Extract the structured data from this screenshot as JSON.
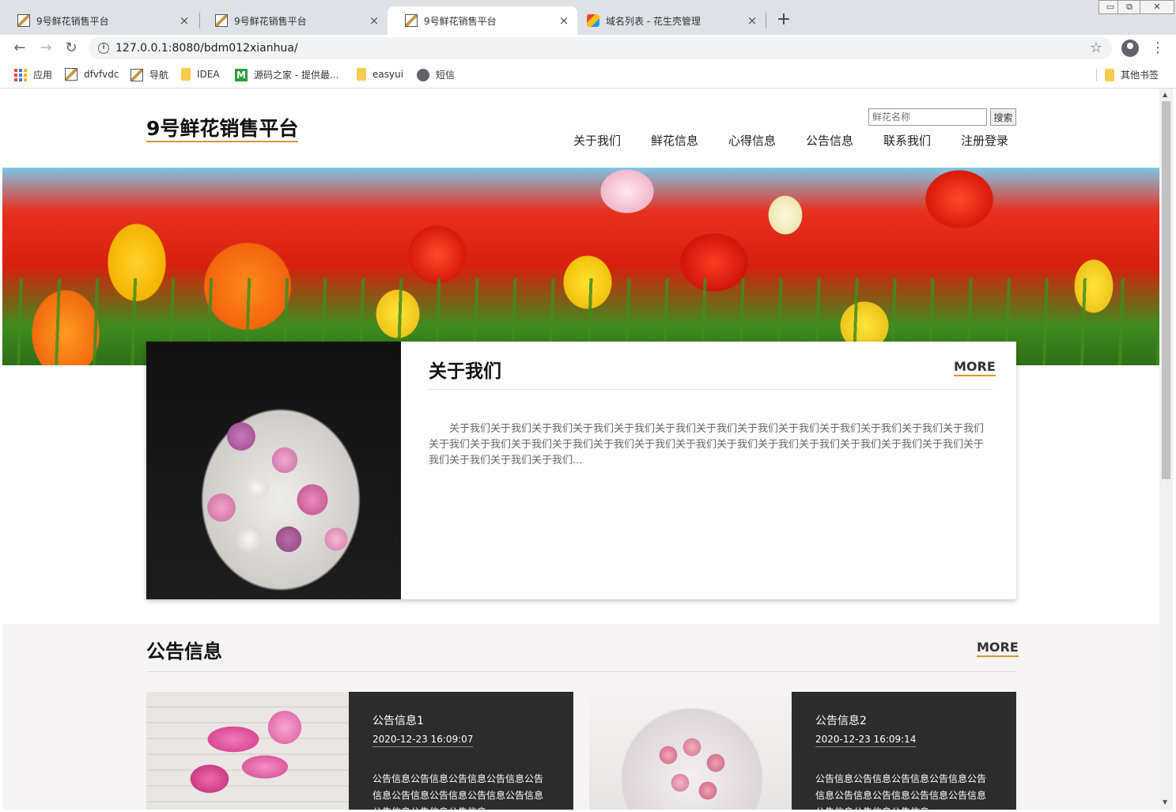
{
  "browser": {
    "tabs": [
      {
        "title": "9号鲜花销售平台",
        "active": false
      },
      {
        "title": "9号鲜花销售平台",
        "active": false
      },
      {
        "title": "9号鲜花销售平台",
        "active": true
      },
      {
        "title": "域名列表 - 花生壳管理",
        "active": false
      }
    ],
    "tab_close": "×",
    "new_tab": "+",
    "window_controls": {
      "minimize": "▭",
      "restore": "⧉",
      "close": "✕"
    },
    "url": "127.0.0.1:8080/bdm012xianhua/",
    "nav": {
      "back": "←",
      "forward": "→",
      "reload": "↻"
    },
    "star": "☆",
    "menu": "⋮",
    "bookmarks": [
      {
        "label": "应用",
        "icon": "apps-icon"
      },
      {
        "label": "dfvfvdc",
        "icon": "picture-icon"
      },
      {
        "label": "导航",
        "icon": "picture-icon"
      },
      {
        "label": "IDEA",
        "icon": "folder-icon"
      },
      {
        "label": "源码之家 - 提供最...",
        "icon": "m-logo-icon"
      },
      {
        "label": "easyui",
        "icon": "folder-icon"
      },
      {
        "label": "短信",
        "icon": "globe-icon"
      }
    ],
    "other_bookmarks": "其他书签"
  },
  "site": {
    "logo": "9号鲜花销售平台",
    "search": {
      "placeholder": "鲜花名称",
      "button": "搜索"
    },
    "nav": [
      "关于我们",
      "鲜花信息",
      "心得信息",
      "公告信息",
      "联系我们",
      "注册登录"
    ],
    "about": {
      "title": "关于我们",
      "more": "MORE",
      "text": "关于我们关于我们关于我们关于我们关于我们关于我们关于我们关于我们关于我们关于我们关于我们关于我们关于我们关于我们关于我们关于我们关于我们关于我们关于我们关于我们关于我们关于我们关于我们关于我们关于我们关于我们关于我们关于我们关于我们关于我们..."
    },
    "notices": {
      "title": "公告信息",
      "more": "MORE",
      "items": [
        {
          "name": "公告信息1",
          "date": "2020-12-23 16:09:07",
          "body": "公告信息公告信息公告信息公告信息公告信息公告信息公告信息公告信息公告信息公告信息公告信息公告信息"
        },
        {
          "name": "公告信息2",
          "date": "2020-12-23 16:09:14",
          "body": "公告信息公告信息公告信息公告信息公告信息公告信息公告信息公告信息公告信息公告信息公告信息公告信息"
        }
      ]
    }
  },
  "colors": {
    "accent_underline": "#d49a2c",
    "notice_card_bg": "#2c2c2c",
    "notice_section_bg": "#f7f4f5"
  }
}
